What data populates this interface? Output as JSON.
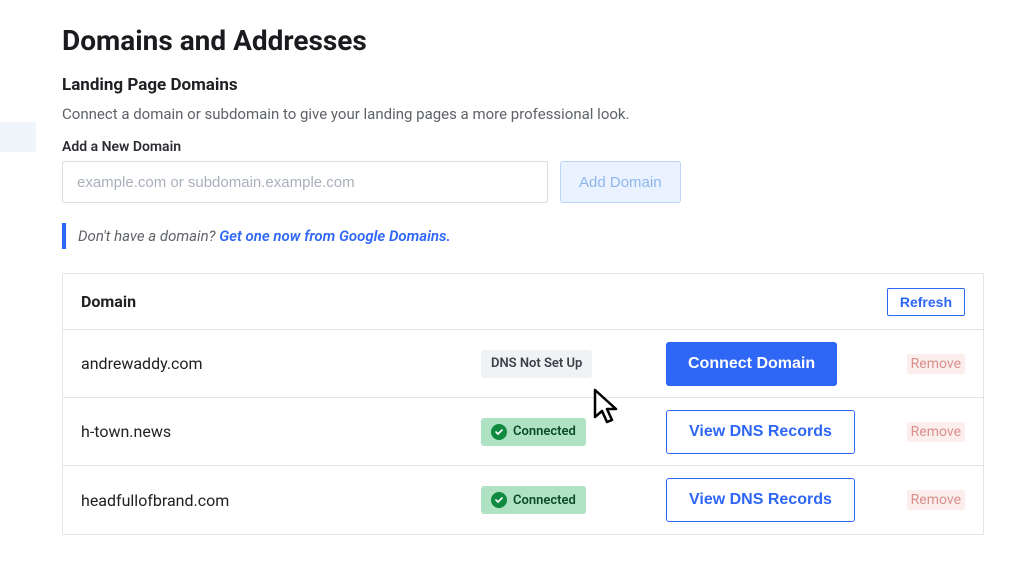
{
  "header": {
    "title": "Domains and Addresses",
    "subtitle": "Landing Page Domains",
    "description": "Connect a domain or subdomain to give your landing pages a more professional look."
  },
  "add_form": {
    "label": "Add a New Domain",
    "placeholder": "example.com or subdomain.example.com",
    "button_label": "Add Domain"
  },
  "hint": {
    "prefix": "Don't have a domain? ",
    "link_text": "Get one now from Google Domains."
  },
  "table": {
    "header_label": "Domain",
    "refresh_label": "Refresh",
    "rows": [
      {
        "domain": "andrewaddy.com",
        "status": "DNS Not Set Up",
        "status_kind": "notsetup",
        "action_label": "Connect Domain",
        "action_kind": "primary",
        "remove_label": "Remove"
      },
      {
        "domain": "h-town.news",
        "status": "Connected",
        "status_kind": "connected",
        "action_label": "View DNS Records",
        "action_kind": "secondary",
        "remove_label": "Remove"
      },
      {
        "domain": "headfullofbrand.com",
        "status": "Connected",
        "status_kind": "connected",
        "action_label": "View DNS Records",
        "action_kind": "secondary",
        "remove_label": "Remove"
      }
    ]
  }
}
